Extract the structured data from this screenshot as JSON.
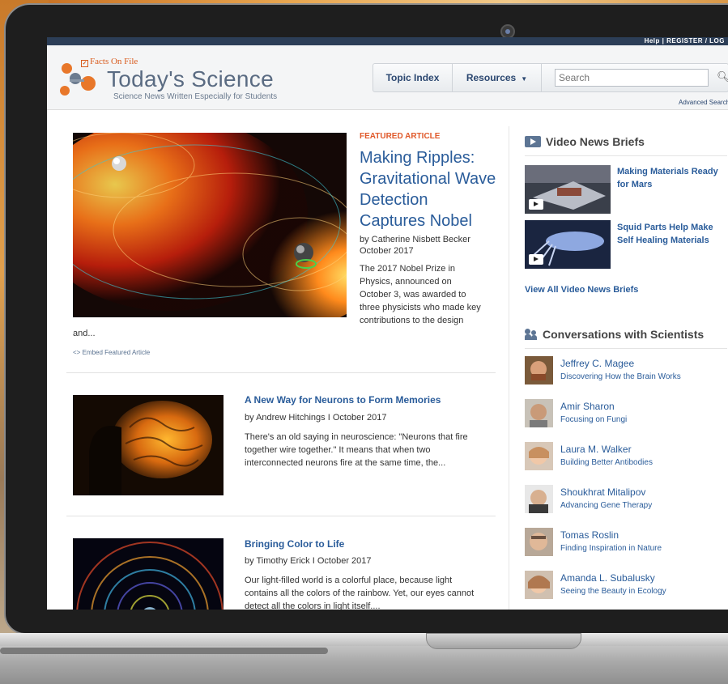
{
  "site": {
    "publisher": "Facts On File",
    "title": "Today's Science",
    "tagline": "Science News Written Especially for Students",
    "topbar_text": "Help | REGISTER / LOG"
  },
  "nav": {
    "topic_index": "Topic Index",
    "resources": "Resources",
    "resources_arrow": "▼",
    "search_placeholder": "Search",
    "advanced_search": "Advanced Search"
  },
  "featured": {
    "label": "FEATURED ARTICLE",
    "title": "Making Ripples: Gravitational Wave Detection Captures Nobel",
    "author": "by Catherine Nisbett Becker",
    "date": "October 2017",
    "summary": "The 2017 Nobel Prize in Physics, announced on October 3, was awarded to three physicists who made key contributions to the design",
    "summary_tail": "and...",
    "embed": "<> Embed Featured Article"
  },
  "articles": [
    {
      "title": "A New Way for Neurons to Form Memories",
      "meta": "by Andrew Hitchings I October 2017",
      "summary": "There's an old saying in neuroscience: \"Neurons that fire together wire together.\" It means that when two interconnected neurons fire at the same time, the..."
    },
    {
      "title": "Bringing Color to Life",
      "meta": "by Timothy Erick I October 2017",
      "summary": "Our light-filled world is a colorful place, because light contains all the colors of the rainbow. Yet, our eyes cannot detect all the colors in light itself...."
    }
  ],
  "video_briefs": {
    "heading": "Video News Briefs",
    "items": [
      {
        "title": "Making Materials Ready for Mars"
      },
      {
        "title": "Squid Parts Help Make Self Healing Materials"
      }
    ],
    "view_all": "View All Video News Briefs"
  },
  "conversations": {
    "heading": "Conversations with Scientists",
    "items": [
      {
        "name": "Jeffrey C. Magee",
        "topic": "Discovering How the Brain Works"
      },
      {
        "name": "Amir Sharon",
        "topic": "Focusing on Fungi"
      },
      {
        "name": "Laura M. Walker",
        "topic": "Building Better Antibodies"
      },
      {
        "name": "Shoukhrat Mitalipov",
        "topic": "Advancing Gene Therapy"
      },
      {
        "name": "Tomas Roslin",
        "topic": "Finding Inspiration in Nature"
      },
      {
        "name": "Amanda L. Subalusky",
        "topic": "Seeing the Beauty in Ecology"
      }
    ]
  },
  "icons": {
    "search": "magnifier",
    "video": "play-rectangle",
    "people": "two-people"
  },
  "colors": {
    "link_blue": "#2a5c9a",
    "accent_orange": "#e0592a",
    "header_title": "#5a6b82"
  }
}
